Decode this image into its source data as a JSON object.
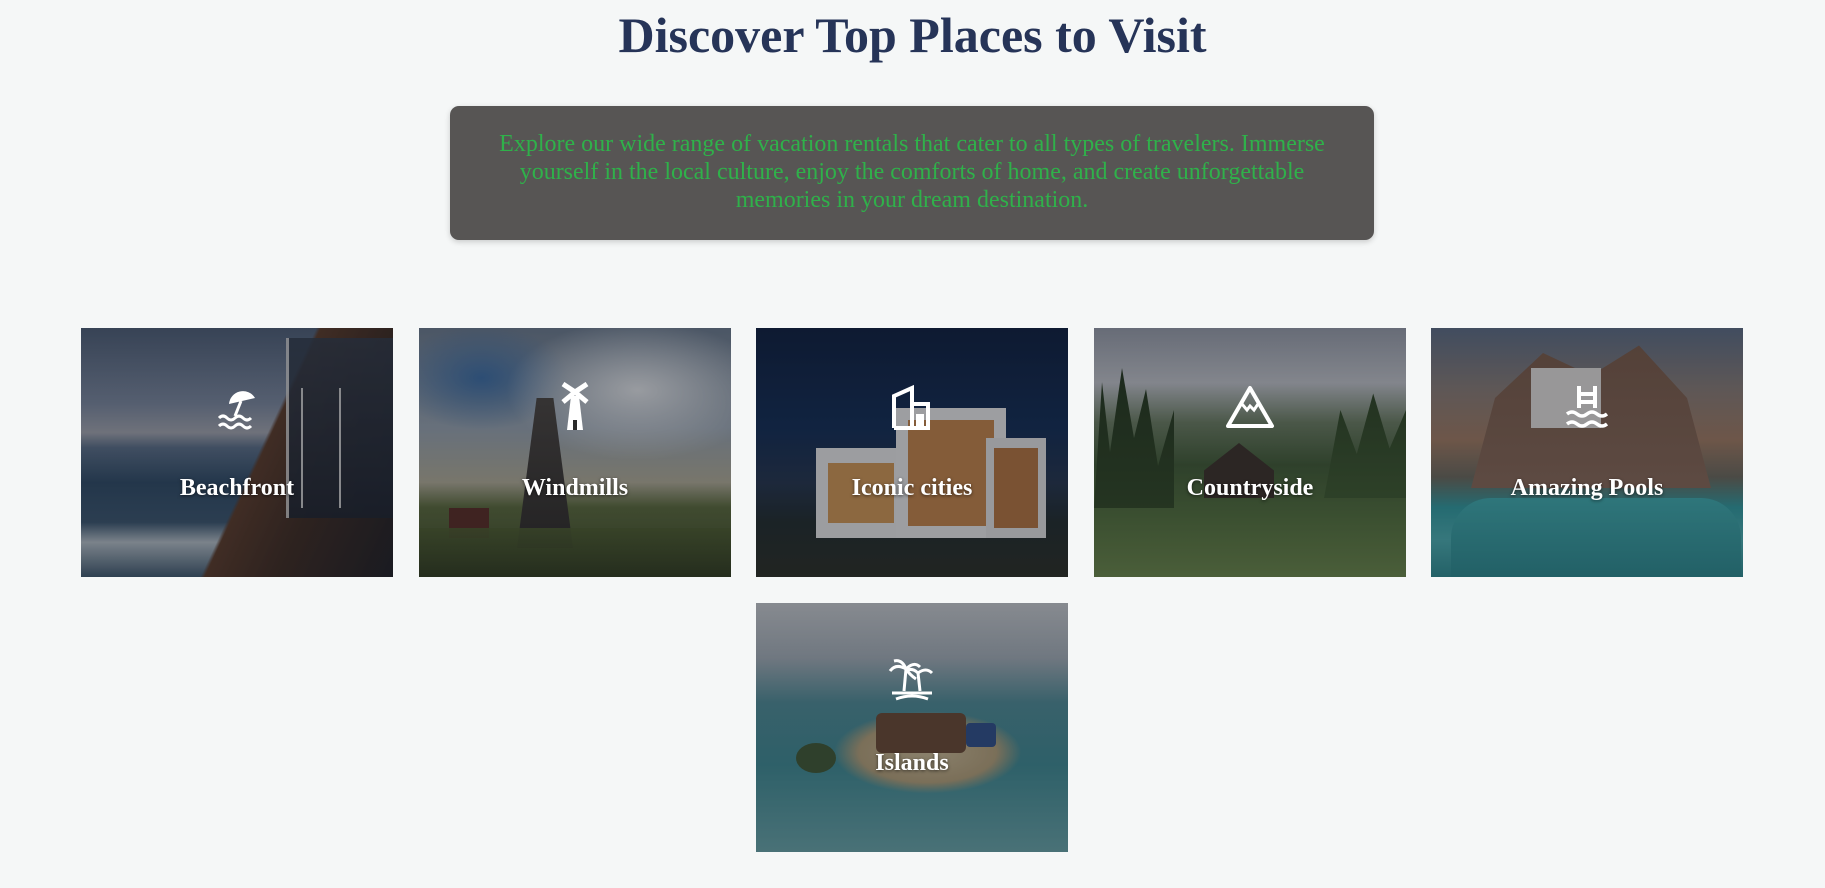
{
  "page": {
    "title": "Discover Top Places to Visit",
    "intro": "Explore our wide range of vacation rentals that cater to all types of travelers. Immerse yourself in the local culture, enjoy the comforts of home, and create unforgettable memories in your dream destination."
  },
  "colors": {
    "title": "#263458",
    "intro_bg": "#575554",
    "intro_text": "#2fb14a",
    "card_label": "#ffffff",
    "page_bg": "#f5f7f7"
  },
  "categories": [
    {
      "label": "Beachfront",
      "icon": "beach-umbrella-icon"
    },
    {
      "label": "Windmills",
      "icon": "windmill-icon"
    },
    {
      "label": "Iconic cities",
      "icon": "building-icon"
    },
    {
      "label": "Countryside",
      "icon": "mountain-icon"
    },
    {
      "label": "Amazing Pools",
      "icon": "pool-icon"
    },
    {
      "label": "Islands",
      "icon": "island-palm-icon"
    }
  ]
}
